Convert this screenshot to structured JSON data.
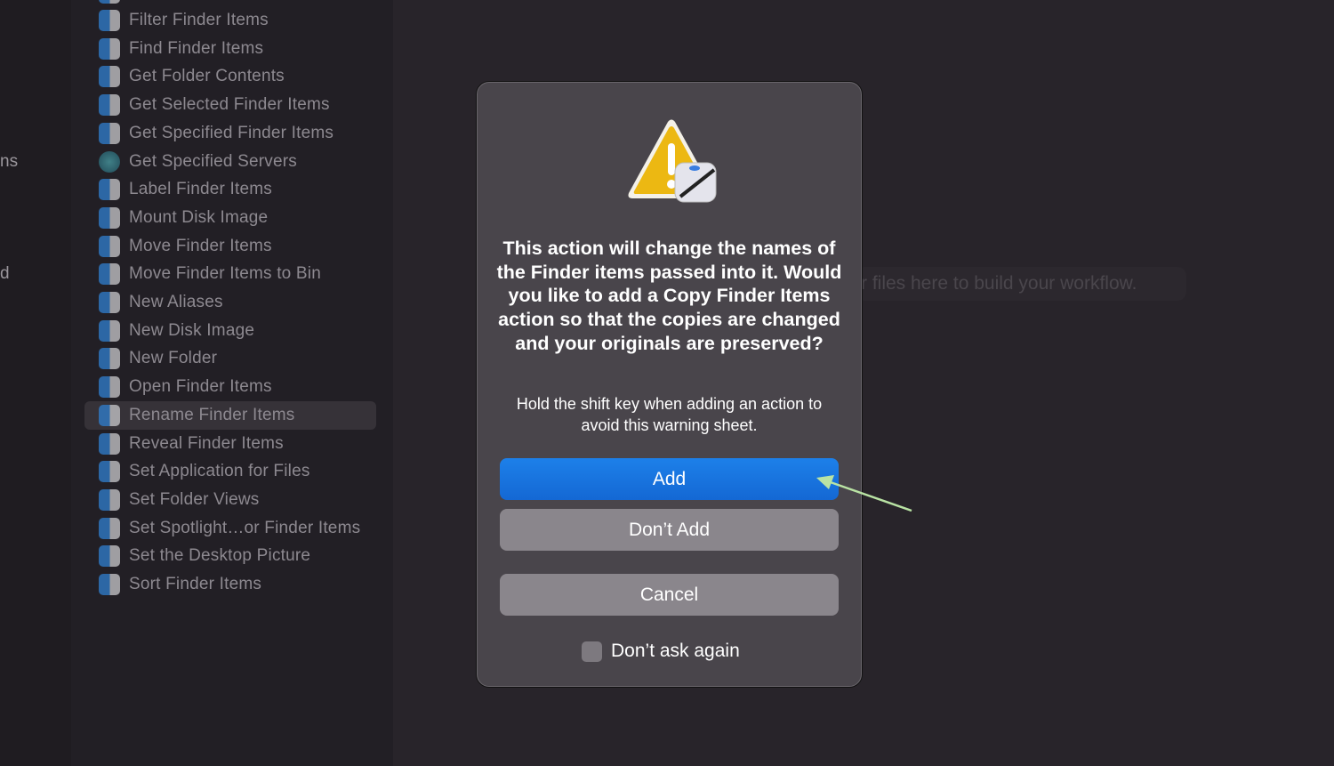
{
  "left_fragments": [
    "ns",
    "d"
  ],
  "sidebar": {
    "selected": "Rename Finder Items",
    "items": [
      {
        "label": "Filter Finder Items",
        "icon": "finder-icon"
      },
      {
        "label": "Find Finder Items",
        "icon": "finder-icon"
      },
      {
        "label": "Get Folder Contents",
        "icon": "finder-icon"
      },
      {
        "label": "Get Selected Finder Items",
        "icon": "finder-icon"
      },
      {
        "label": "Get Specified Finder Items",
        "icon": "finder-icon"
      },
      {
        "label": "Get Specified Servers",
        "icon": "globe-icon"
      },
      {
        "label": "Label Finder Items",
        "icon": "finder-icon"
      },
      {
        "label": "Mount Disk Image",
        "icon": "finder-icon"
      },
      {
        "label": "Move Finder Items",
        "icon": "finder-icon"
      },
      {
        "label": "Move Finder Items to Bin",
        "icon": "finder-icon"
      },
      {
        "label": "New Aliases",
        "icon": "finder-icon"
      },
      {
        "label": "New Disk Image",
        "icon": "finder-icon"
      },
      {
        "label": "New Folder",
        "icon": "finder-icon"
      },
      {
        "label": "Open Finder Items",
        "icon": "finder-icon"
      },
      {
        "label": "Rename Finder Items",
        "icon": "finder-icon"
      },
      {
        "label": "Reveal Finder Items",
        "icon": "finder-icon"
      },
      {
        "label": "Set Application for Files",
        "icon": "finder-icon"
      },
      {
        "label": "Set Folder Views",
        "icon": "finder-icon"
      },
      {
        "label": "Set Spotlight…or Finder Items",
        "icon": "finder-icon"
      },
      {
        "label": "Set the Desktop Picture",
        "icon": "finder-icon"
      },
      {
        "label": "Sort Finder Items",
        "icon": "finder-icon"
      }
    ]
  },
  "workflow": {
    "placeholder": "r files here to build your workflow."
  },
  "dialog": {
    "icon": "warning-automator-icon",
    "message": "This action will change the names of the Finder items passed into it. Would you like to add a Copy Finder Items action so that the copies are changed and your originals are preserved?",
    "info": "Hold the shift key when adding an action to avoid this warning sheet.",
    "add_label": "Add",
    "dont_add_label": "Don’t Add",
    "cancel_label": "Cancel",
    "checkbox_label": "Don’t ask again",
    "checkbox_checked": false
  },
  "annotation": {
    "arrow_color": "#b9e3a4"
  }
}
